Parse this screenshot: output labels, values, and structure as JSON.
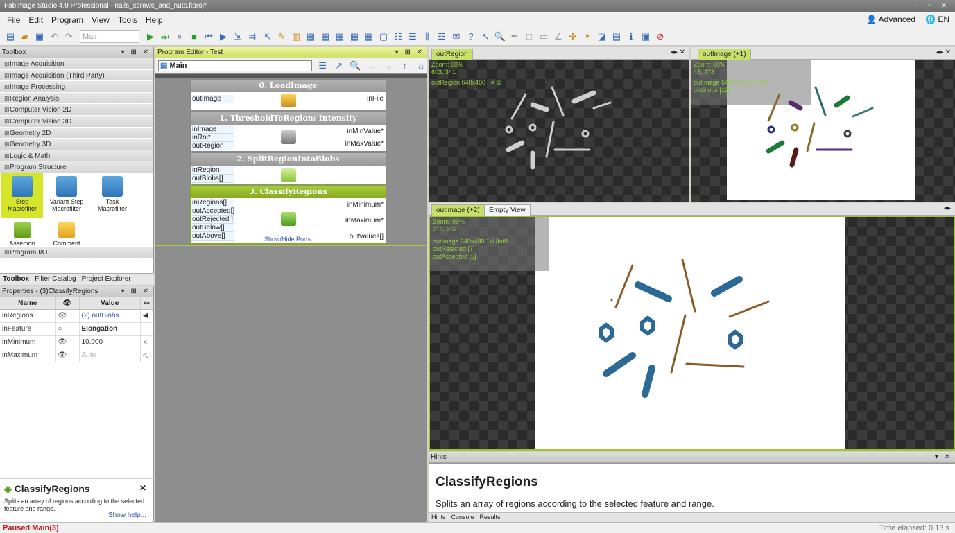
{
  "window": {
    "title": "FabImage Studio 4.9 Professional - nails_screws_and_nuts.fiproj*"
  },
  "menu": [
    "File",
    "Edit",
    "Program",
    "View",
    "Tools",
    "Help"
  ],
  "menu_right": {
    "mode": "Advanced",
    "lang": "EN"
  },
  "toolbar": {
    "combo": "Main"
  },
  "toolbox": {
    "title": "Toolbox",
    "categories": [
      "Image Acquisition",
      "Image Acquisition (Third Party)",
      "Image Processing",
      "Region Analysis",
      "Computer Vision 2D",
      "Computer Vision 3D",
      "Geometry 2D",
      "Geometry 3D",
      "Logic & Math",
      "Program Structure"
    ],
    "tiles": [
      "Step Macrofilter",
      "Variant Step Macrofilter",
      "Task Macrofilter",
      "Assertion",
      "Comment"
    ],
    "last_category": "Program I/O"
  },
  "bottom_tabs": [
    "Toolbox",
    "Filter Catalog",
    "Project Explorer"
  ],
  "properties": {
    "title": "Properties - (3)ClassifyRegions",
    "headers": [
      "Name",
      "Value"
    ],
    "rows": [
      {
        "name": "inRegions",
        "value": "(2).outBlobs"
      },
      {
        "name": "inFeature",
        "value": "Elongation"
      },
      {
        "name": "inMinimum",
        "value": "10.000"
      },
      {
        "name": "inMaximum",
        "value": "Auto"
      }
    ]
  },
  "help": {
    "title": "ClassifyRegions",
    "desc": "Splits an array of regions according to the selected feature and range.",
    "link": "Show help..."
  },
  "editor": {
    "title": "Program Editor - Test",
    "selector": "Main",
    "blocks": [
      {
        "title": "0. LoadImage",
        "in": [
          "outImage"
        ],
        "out": [
          "inFile"
        ]
      },
      {
        "title": "1. ThresholdToRegion: Intensity",
        "in": [
          "inImage",
          "inRoi*",
          "outRegion"
        ],
        "out": [
          "inMinValue*",
          "inMaxValue*"
        ]
      },
      {
        "title": "2. SplitRegionIntoBlobs",
        "in": [
          "inRegion",
          "outBlobs[]"
        ],
        "out": []
      },
      {
        "title": "3. ClassifyRegions",
        "in": [
          "inRegions[]",
          "outAccepted[]",
          "outRejected[]",
          "outBelow[]",
          "outAbove[]"
        ],
        "out": [
          "inMinimum*",
          "inMaximum*",
          "outValues[]"
        ],
        "footer": "Show/Hide Ports"
      }
    ]
  },
  "viewer1": {
    "tab": "outRegion",
    "zoom": "Zoom: 60%",
    "coords": "603, 341",
    "layer": "outRegion 640x480"
  },
  "viewer2": {
    "tab": "outImage (+1)",
    "zoom": "Zoom: 60%",
    "coords": "48, 478",
    "layer1": "outImage 640x480 1xUInt8",
    "layer2": "outBlobs [12]"
  },
  "viewer3": {
    "tab": "outImage (+2)",
    "tab2": "Empty View",
    "zoom": "Zoom: 99%",
    "coords": "215, 262",
    "layer1": "outImage 640x480 1xUInt8",
    "layer2": "outRejected [7]",
    "layer3": "outAccepted [5]"
  },
  "hints": {
    "title": "Hints",
    "heading": "ClassifyRegions",
    "desc": "Splits an array of regions according to the selected feature and range.",
    "tabs": [
      "Hints",
      "Console",
      "Results"
    ]
  },
  "status": {
    "left": "Paused  Main(3)",
    "right": "Time elapsed: 0.13 s"
  },
  "colors": {
    "accent": "#9fc433",
    "rejected": "#8a5a28",
    "accepted": "#2b6a94"
  }
}
